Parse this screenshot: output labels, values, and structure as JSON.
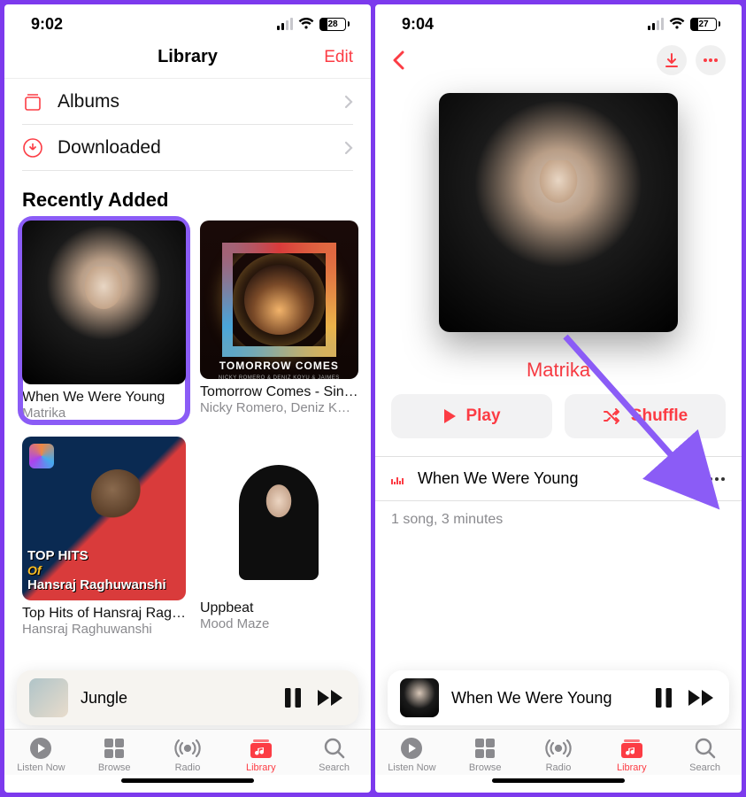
{
  "left": {
    "status": {
      "time": "9:02",
      "battery_pct": "28",
      "battery_fill": 28
    },
    "nav": {
      "title": "Library",
      "edit": "Edit"
    },
    "rows": [
      {
        "icon": "albums",
        "label": "Albums"
      },
      {
        "icon": "downloaded",
        "label": "Downloaded"
      }
    ],
    "section_title": "Recently Added",
    "cards": [
      {
        "title": "When We Were Young",
        "subtitle": "Matrika",
        "art": "matrika",
        "highlight": true
      },
      {
        "title": "Tomorrow Comes - Sin…",
        "subtitle": "Nicky Romero, Deniz K…",
        "art": "tomorrow",
        "cap": "TOMORROW COMES",
        "capsub": "NICKY ROMERO & DENIZ KOYU & JAIMES"
      },
      {
        "title": "Top Hits of Hansraj Rag…",
        "subtitle": "Hansraj Raghuwanshi",
        "art": "tophits",
        "line1": "TOP HITS",
        "of": "Of",
        "line2": "Hansraj Raghuwanshi"
      },
      {
        "title": "Uppbeat",
        "subtitle": "Mood Maze",
        "art": "uppbeat"
      }
    ],
    "now_playing": {
      "title": "Jungle"
    }
  },
  "right": {
    "status": {
      "time": "9:04",
      "battery_pct": "27",
      "battery_fill": 27
    },
    "artist": "Matrika",
    "play": "Play",
    "shuffle": "Shuffle",
    "track": {
      "title": "When We Were Young"
    },
    "meta": "1 song, 3 minutes",
    "now_playing": {
      "title": "When We Were Young"
    }
  },
  "tabs": [
    {
      "key": "listen",
      "label": "Listen Now"
    },
    {
      "key": "browse",
      "label": "Browse"
    },
    {
      "key": "radio",
      "label": "Radio"
    },
    {
      "key": "library",
      "label": "Library"
    },
    {
      "key": "search",
      "label": "Search"
    }
  ]
}
